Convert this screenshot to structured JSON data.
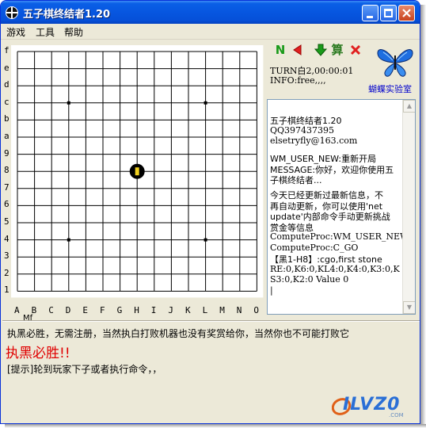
{
  "window": {
    "title": "五子棋终结者1.20"
  },
  "menu": {
    "items": [
      "游戏",
      "工具",
      "帮助"
    ]
  },
  "board": {
    "row_labels": [
      "f",
      "e",
      "d",
      "c",
      "b",
      "a",
      "9",
      "8",
      "7",
      "6",
      "5",
      "4",
      "3",
      "2",
      "1"
    ],
    "col_labels": [
      "A",
      "B",
      "C",
      "D",
      "E",
      "F",
      "G",
      "H",
      "I",
      "J",
      "K",
      "L",
      "M",
      "N",
      "O"
    ],
    "footer_label": "Mf",
    "stone": {
      "color": "black",
      "col": "H",
      "row": "8"
    },
    "star_points": [
      [
        "D",
        "c"
      ],
      [
        "L",
        "c"
      ],
      [
        "D",
        "4"
      ],
      [
        "L",
        "4"
      ]
    ]
  },
  "toolbar": {
    "icons": [
      "n-green-icon",
      "back-red-icon",
      "down-green-icon",
      "calc-icon",
      "cancel-red-icon"
    ],
    "calc_label": "算"
  },
  "status": {
    "turn": "TURN白2,00:00:01",
    "info": "INFO:free,,,,"
  },
  "brand": {
    "lab_link": "蝴蝶实验室"
  },
  "log": {
    "lines": [
      "五子棋终结者1.20",
      "QQ397437395",
      "elsetryfly@163.com",
      "",
      "WM_USER_NEW:重新开局",
      "MESSAGE:你好，欢迎你使用五",
      "子棋终结者...",
      "",
      "今天已经更新过最新信息，不",
      "再自动更新，你可以使用'net",
      "update'内部命令手动更新挑战",
      "赏金等信息",
      "ComputeProc:WM_USER_NEW",
      "ComputeProc:C_GO",
      "【黑1-H8】:cgo,first stone",
      "RE:0,K6:0,KL4:0,K4:0,K3:0,K",
      "S3:0,K2:0 Value 0",
      "|"
    ]
  },
  "bottom": {
    "line1": "执黑必胜，无需注册，当然执白打败机器也没有奖赏给你，当然你也不可能打败它",
    "line2": "执黑必胜!!",
    "line3": "[提示]轮到玩家下子或者执行命令，，"
  },
  "logo": {
    "text": "ILVZ0",
    "sub": ".COM"
  },
  "colors": {
    "titlebar": "#0756e0",
    "highlight_red": "#e00000",
    "link_blue": "#0000cc"
  }
}
